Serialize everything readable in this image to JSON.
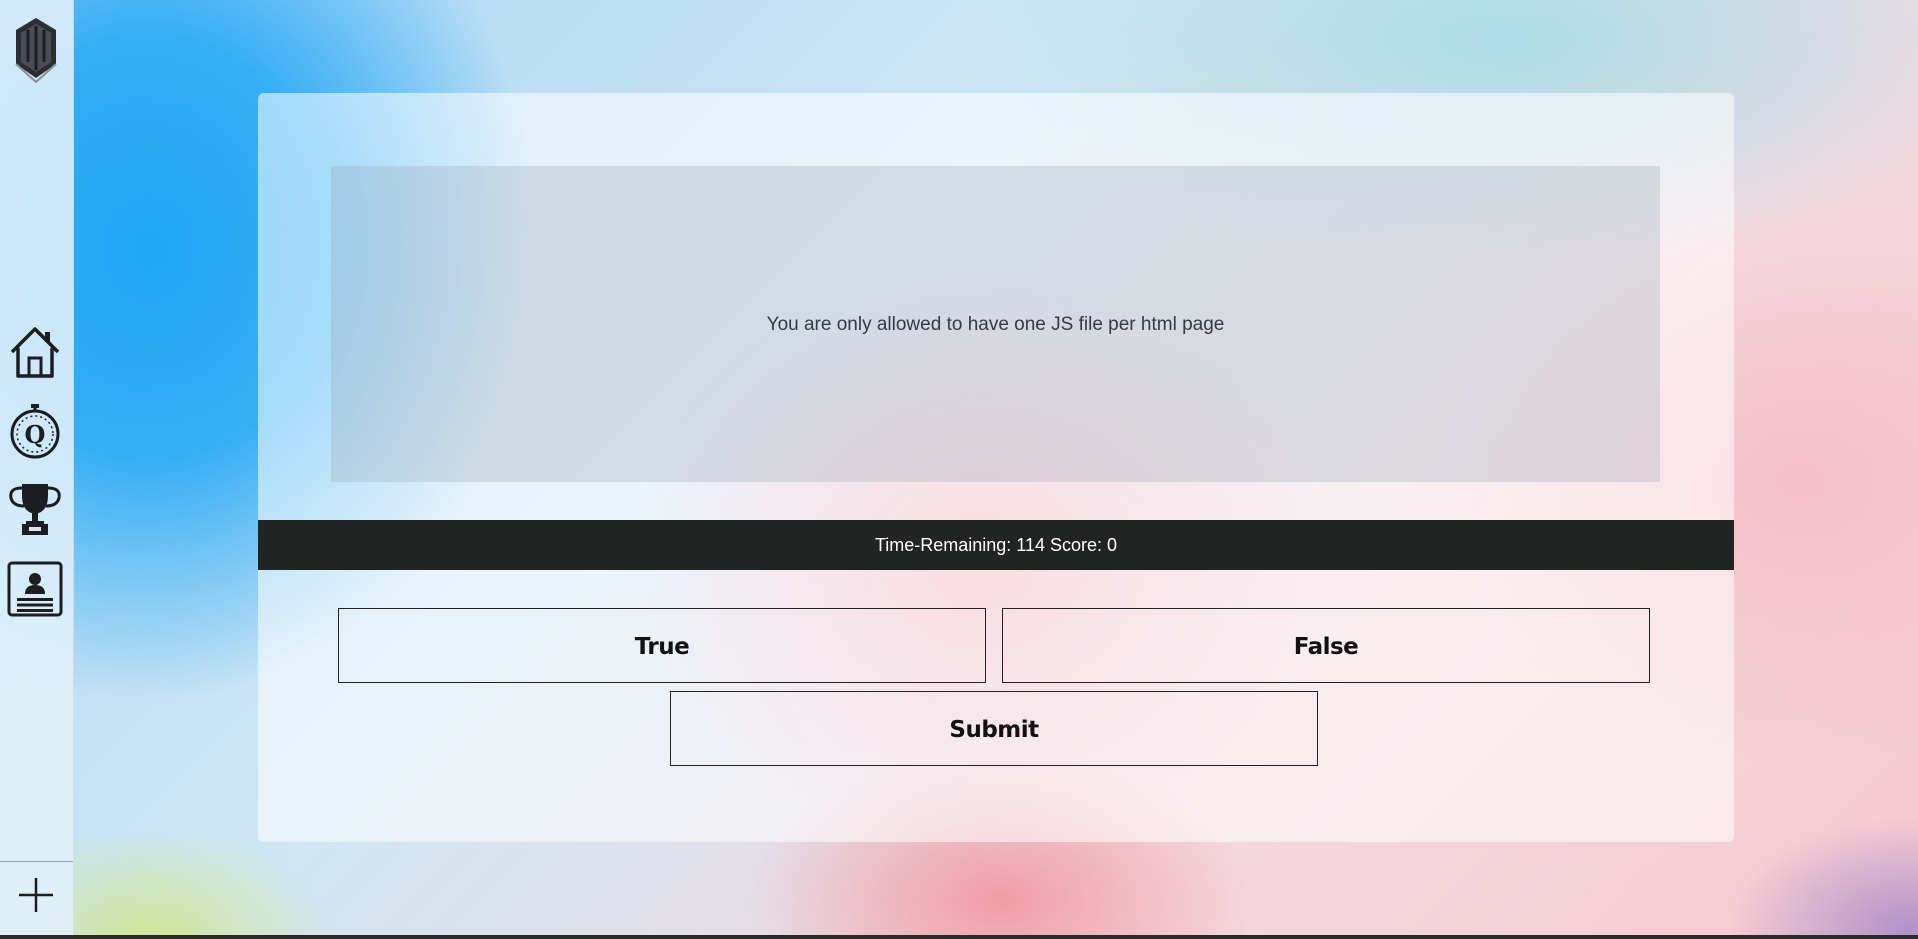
{
  "sidebar": {
    "logo_icon": "shield-logo-icon",
    "items": [
      {
        "name": "home",
        "icon": "house-icon"
      },
      {
        "name": "quiz",
        "icon": "stopwatch-q-icon"
      },
      {
        "name": "leaderboard",
        "icon": "trophy-icon"
      },
      {
        "name": "profile",
        "icon": "id-card-icon"
      }
    ],
    "add_icon": "plus-icon"
  },
  "quiz": {
    "question": "You are only allowed to have one JS file per html page",
    "status": "Time-Remaining: 114 Score: 0",
    "answers": {
      "true_label": "True",
      "false_label": "False"
    },
    "submit_label": "Submit"
  },
  "colors": {
    "status_bar_bg": "#222323",
    "button_border": "#222222"
  }
}
